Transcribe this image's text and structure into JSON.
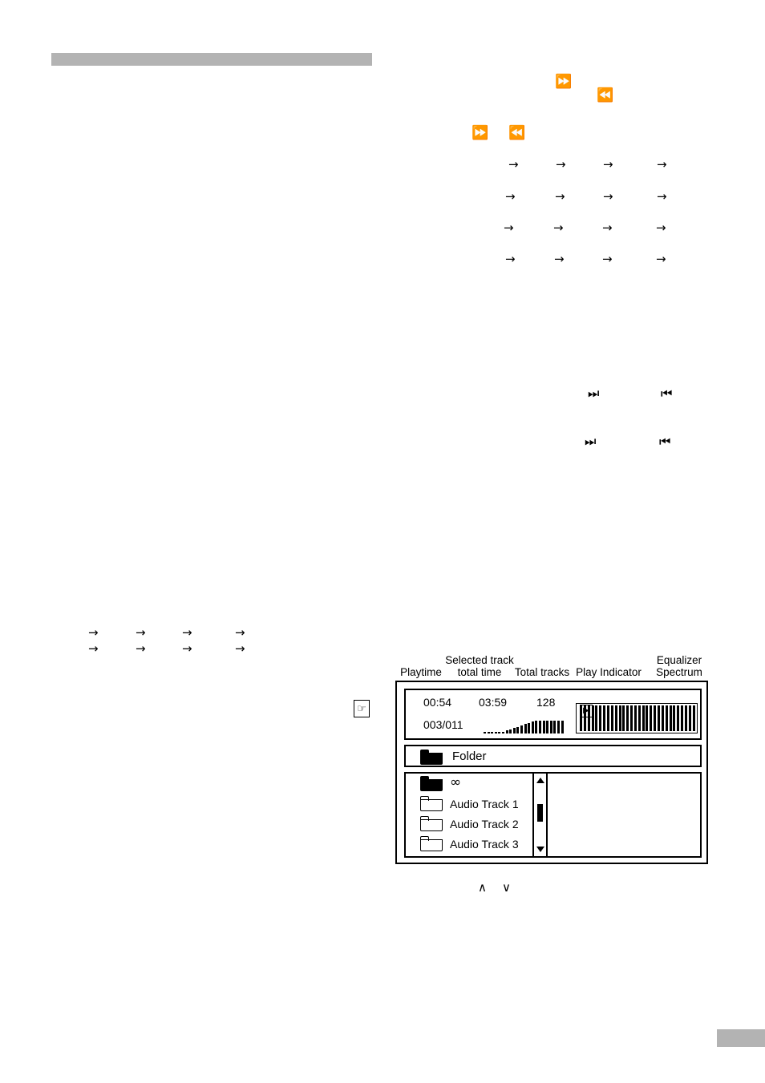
{
  "page": {
    "header_bar": "",
    "footer_tab": ""
  },
  "symbols": {
    "fast_forward": "⏩",
    "fast_rewind": "⏪",
    "next_track": "⏭",
    "prev_track": "⏮",
    "arrow_right": "→",
    "caret_up": "∧",
    "caret_down": "∨",
    "play": "▶",
    "infinity": "∞",
    "hand": "☞"
  },
  "glyph_rows": {
    "row1": [
      "⏩"
    ],
    "row2": [
      "⏪"
    ],
    "row3": [
      "⏩",
      "⏪"
    ],
    "arrows_grid": [
      [
        "→",
        "→",
        "→",
        "→"
      ],
      [
        "→",
        "→",
        "→",
        "→"
      ],
      [
        "→",
        "→",
        "→",
        "→"
      ],
      [
        "→",
        "→",
        "→",
        "→"
      ]
    ],
    "track_nav": [
      [
        "⏭",
        "⏮"
      ],
      [
        "⏭",
        "⏮"
      ]
    ],
    "left_arrows": [
      [
        "→",
        "→",
        "→",
        "→"
      ],
      [
        "→",
        "→",
        "→",
        "→"
      ]
    ]
  },
  "figure": {
    "callouts": {
      "playtime": "Playtime",
      "selected_track_total_time": "Selected track\ntotal time",
      "total_tracks": "Total tracks",
      "play_indicator": "Play Indicator",
      "equalizer_spectrum": "Equalizer\nSpectrum"
    },
    "display": {
      "playtime_value": "00:54",
      "track_total_time_value": "03:59",
      "total_tracks_value": "128",
      "play_indicator_glyph": "▶",
      "track_counter": "003/011",
      "folder_bar_label": "Folder",
      "list": {
        "rows": [
          {
            "icon": "folder-filled-icon",
            "label": "∞"
          },
          {
            "icon": "folder-outline-icon",
            "label": "Audio Track 1"
          },
          {
            "icon": "folder-outline-icon",
            "label": "Audio Track 2"
          },
          {
            "icon": "folder-outline-icon",
            "label": "Audio Track 3"
          }
        ]
      }
    },
    "caret_controls": [
      "∧",
      "∨"
    ]
  }
}
